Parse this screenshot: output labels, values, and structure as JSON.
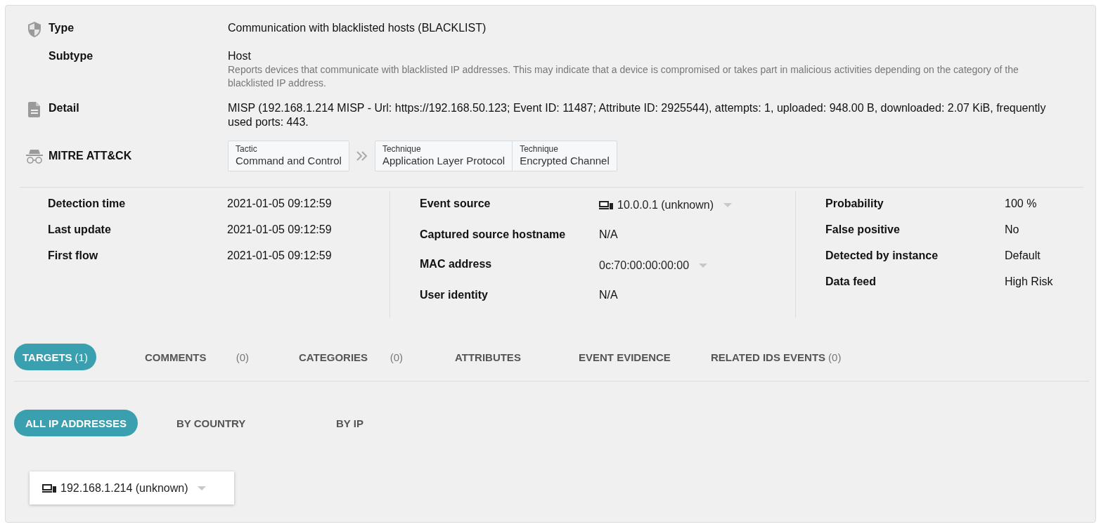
{
  "summary": [
    {
      "kind": "shield",
      "label": "Type",
      "value": "Communication with blacklisted hosts (BLACKLIST)"
    },
    {
      "kind": "none",
      "label": "Subtype",
      "value": "Host",
      "description": "Reports devices that communicate with blacklisted IP addresses. This may indicate that a device is compromised or takes part in malicious activities depending on the category of the blacklisted IP address."
    },
    {
      "kind": "document",
      "label": "Detail",
      "value": "MISP (192.168.1.214 MISP - Url: https://192.168.50.123; Event ID: 11487; Attribute ID: 2925544), attempts: 1, uploaded: 948.00 B, downloaded: 2.07 KiB, frequently used ports: 443."
    }
  ],
  "mitre": {
    "label": "MITRE ATT&CK",
    "tactic": {
      "heading": "Tactic",
      "name": "Command and Control"
    },
    "techniques": [
      {
        "heading": "Technique",
        "name": "Application Layer Protocol"
      },
      {
        "heading": "Technique",
        "name": "Encrypted Channel"
      }
    ]
  },
  "info_columns": [
    [
      {
        "kind": "text",
        "label": "Detection time",
        "value": "2021-01-05 09:12:59"
      },
      {
        "kind": "text",
        "label": "Last update",
        "value": "2021-01-05 09:12:59"
      },
      {
        "kind": "text",
        "label": "First flow",
        "value": "2021-01-05 09:12:59"
      }
    ],
    [
      {
        "kind": "host",
        "label": "Event source",
        "value": "10.0.0.1 (unknown)"
      },
      {
        "kind": "text",
        "label": "Captured source hostname",
        "value": "N/A"
      },
      {
        "kind": "dropdown",
        "label": "MAC address",
        "value": "0c:70:00:00:00:00"
      },
      {
        "kind": "text",
        "label": "User identity",
        "value": "N/A"
      }
    ],
    [
      {
        "kind": "text",
        "label": "Probability",
        "value": "100 %"
      },
      {
        "kind": "text",
        "label": "False positive",
        "value": "No"
      },
      {
        "kind": "text",
        "label": "Detected by instance",
        "value": "Default"
      },
      {
        "kind": "text",
        "label": "Data feed",
        "value": "High Risk"
      }
    ]
  ],
  "tabs": [
    {
      "label": "TARGETS",
      "count": "(1)",
      "selected": true
    },
    {
      "label": "COMMENTS",
      "count": "(0)",
      "selected": false
    },
    {
      "label": "CATEGORIES",
      "count": "(0)",
      "selected": false
    },
    {
      "label": "ATTRIBUTES",
      "selected": false
    },
    {
      "label": "EVENT EVIDENCE",
      "selected": false
    },
    {
      "label": "RELATED IDS EVENTS",
      "count": "(0)",
      "selected": false
    }
  ],
  "subtabs": [
    {
      "label": "ALL IP ADDRESSES",
      "selected": true
    },
    {
      "label": "BY COUNTRY",
      "selected": false
    },
    {
      "label": "BY IP",
      "selected": false
    }
  ],
  "targets": [
    {
      "value": "192.168.1.214 (unknown)"
    }
  ]
}
